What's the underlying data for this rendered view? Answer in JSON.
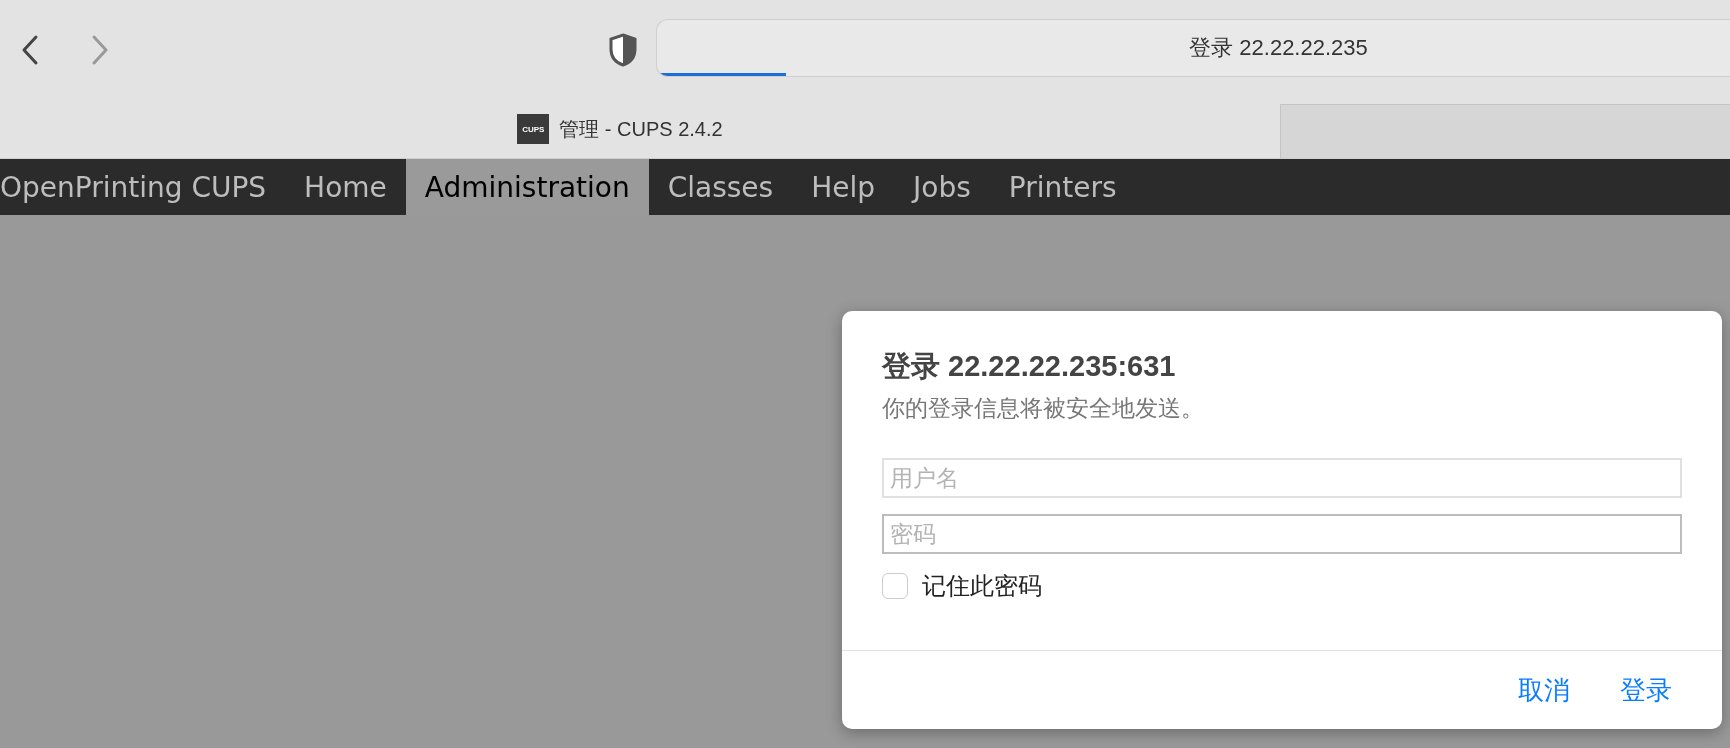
{
  "toolbar": {
    "address": "登录 22.22.22.235",
    "loading": {
      "level": 0.12
    }
  },
  "tabs": [
    {
      "label": "管理 - CUPS 2.4.2",
      "favicon": "CUPS",
      "selected": true
    }
  ],
  "nav": [
    {
      "label": "OpenPrinting CUPS",
      "selected": false
    },
    {
      "label": "Home",
      "selected": false
    },
    {
      "label": "Administration",
      "selected": true
    },
    {
      "label": "Classes",
      "selected": false
    },
    {
      "label": "Help",
      "selected": false
    },
    {
      "label": "Jobs",
      "selected": false
    },
    {
      "label": "Printers",
      "selected": false
    }
  ],
  "dialog": {
    "title": "登录 22.22.22.235:631",
    "subtitle": "你的登录信息将被安全地发送。",
    "fields": [
      {
        "placeholder": "用户名",
        "focused": false
      },
      {
        "placeholder": "密码",
        "focused": true
      }
    ],
    "remember": {
      "label": "记住此密码",
      "checked": false
    },
    "buttons": [
      "取消",
      "登录"
    ]
  }
}
